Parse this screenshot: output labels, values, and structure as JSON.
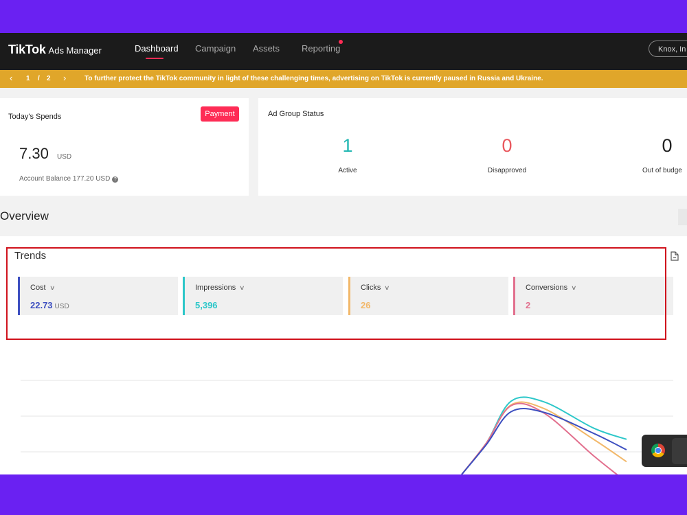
{
  "nav": {
    "brand": "TikTok",
    "brand_sub": "Ads Manager",
    "items": [
      {
        "label": "Dashboard",
        "active": true
      },
      {
        "label": "Campaign",
        "active": false
      },
      {
        "label": "Assets",
        "active": false
      },
      {
        "label": "Reporting",
        "active": false,
        "badge": true
      }
    ],
    "account_label": "Knox, In"
  },
  "notice": {
    "page_current": "1",
    "page_sep": "/",
    "page_total": "2",
    "text": "To further protect the TikTok community in light of these challenging times, advertising on TikTok is currently paused in Russia and Ukraine."
  },
  "spends": {
    "title": "Today's Spends",
    "payment_label": "Payment",
    "value": "7.30",
    "unit": "USD",
    "balance": "Account Balance 177.20 USD"
  },
  "ad_group_status": {
    "title": "Ad Group Status",
    "stats": [
      {
        "value": "1",
        "label": "Active",
        "color": "#21b7b2"
      },
      {
        "value": "0",
        "label": "Disapproved",
        "color": "#e9585e"
      },
      {
        "value": "0",
        "label": "Out of budge",
        "color": "#222222"
      }
    ]
  },
  "overview": {
    "title": "Overview"
  },
  "trends": {
    "title": "Trends",
    "metrics": [
      {
        "label": "Cost",
        "value": "22.73",
        "unit": "USD",
        "color": "#3d4fc0"
      },
      {
        "label": "Impressions",
        "value": "5,396",
        "unit": "",
        "color": "#2cc7c9"
      },
      {
        "label": "Clicks",
        "value": "26",
        "unit": "",
        "color": "#f2b86a"
      },
      {
        "label": "Conversions",
        "value": "2",
        "unit": "",
        "color": "#e2708e"
      }
    ]
  },
  "chart_data": {
    "type": "line",
    "series": [
      {
        "color": "#2cc7c9",
        "points": [
          [
            0.0,
            0.0
          ],
          [
            0.15,
            0.42
          ],
          [
            0.3,
            0.98
          ],
          [
            0.5,
            0.97
          ],
          [
            0.8,
            0.62
          ],
          [
            1.0,
            0.47
          ]
        ]
      },
      {
        "color": "#f2b86a",
        "points": [
          [
            0.0,
            0.0
          ],
          [
            0.15,
            0.42
          ],
          [
            0.3,
            0.93
          ],
          [
            0.5,
            0.88
          ],
          [
            0.8,
            0.47
          ],
          [
            1.0,
            0.17
          ]
        ]
      },
      {
        "color": "#e2708e",
        "points": [
          [
            0.0,
            0.0
          ],
          [
            0.15,
            0.42
          ],
          [
            0.3,
            0.92
          ],
          [
            0.5,
            0.82
          ],
          [
            0.8,
            0.25
          ],
          [
            1.0,
            -0.1
          ]
        ]
      },
      {
        "color": "#3d4fc0",
        "points": [
          [
            0.0,
            0.0
          ],
          [
            0.15,
            0.4
          ],
          [
            0.3,
            0.84
          ],
          [
            0.5,
            0.83
          ],
          [
            0.8,
            0.55
          ],
          [
            1.0,
            0.33
          ]
        ]
      }
    ],
    "grid": true
  }
}
